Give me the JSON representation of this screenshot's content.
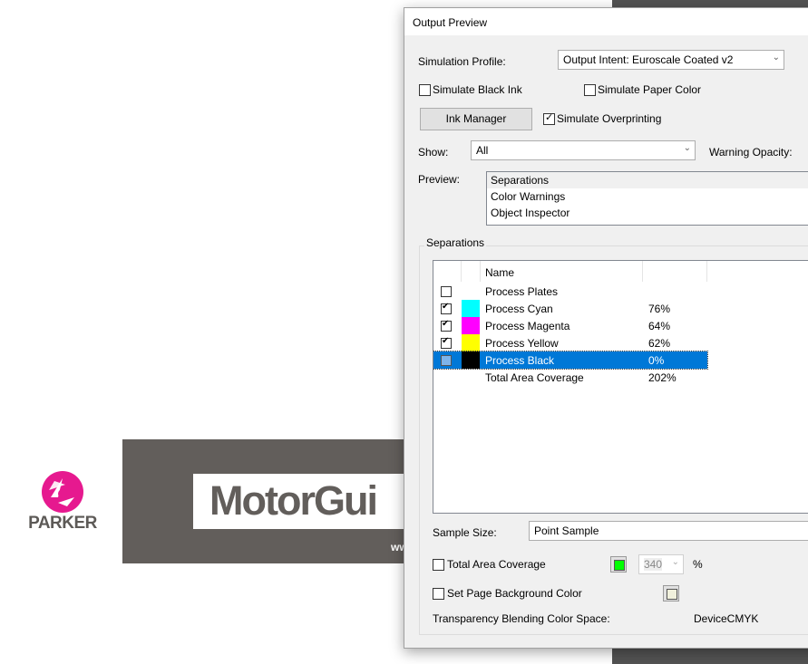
{
  "background": {
    "parker_logo_text": "PARKER",
    "parker_logo_color": "#e6198f",
    "banner_text": "MotorGui",
    "banner_url_fragment": "ww"
  },
  "dialog": {
    "title": "Output Preview",
    "simulation_profile_label": "Simulation Profile:",
    "simulation_profile_value": "Output Intent: Euroscale Coated v2",
    "simulate_black_ink": {
      "label": "Simulate Black Ink",
      "checked": false
    },
    "simulate_paper_color": {
      "label": "Simulate Paper Color",
      "checked": false
    },
    "ink_manager_label": "Ink Manager",
    "simulate_overprinting": {
      "label": "Simulate Overprinting",
      "checked": true
    },
    "show_label": "Show:",
    "show_value": "All",
    "warning_opacity_label": "Warning Opacity:",
    "preview_label": "Preview:",
    "preview_items": [
      "Separations",
      "Color Warnings",
      "Object Inspector"
    ],
    "preview_selected": "Separations",
    "separations_group_label": "Separations",
    "table": {
      "columns": [
        "",
        "",
        "Name",
        ""
      ],
      "rows": [
        {
          "checked": false,
          "swatch": "",
          "name": "Process Plates",
          "percent": ""
        },
        {
          "checked": true,
          "swatch": "#00ffff",
          "name": "Process Cyan",
          "percent": "76%"
        },
        {
          "checked": true,
          "swatch": "#ff00ff",
          "name": "Process Magenta",
          "percent": "64%"
        },
        {
          "checked": true,
          "swatch": "#ffff00",
          "name": "Process Yellow",
          "percent": "62%"
        },
        {
          "checked": "partial",
          "swatch": "#000000",
          "name": "Process Black",
          "percent": "0%",
          "selected": true
        },
        {
          "checked": null,
          "swatch": "",
          "name": "Total Area Coverage",
          "percent": "202%"
        }
      ]
    },
    "sample_size_label": "Sample Size:",
    "sample_size_value": "Point Sample",
    "total_area_coverage": {
      "label": "Total Area Coverage",
      "checked": false,
      "color": "#00ff00",
      "value": "340",
      "unit": "%"
    },
    "set_page_background": {
      "label": "Set Page Background Color",
      "checked": false,
      "color": "#f0f0dc"
    },
    "blending_label": "Transparency Blending Color Space:",
    "blending_value": "DeviceCMYK"
  }
}
